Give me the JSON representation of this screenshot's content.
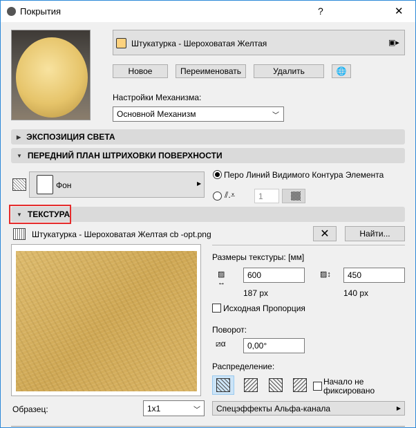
{
  "window": {
    "title": "Покрытия",
    "help": "?",
    "close": "✕"
  },
  "material": {
    "name": "Штукатурка - Шероховатая Желтая",
    "swatch_color": "#fdd27e"
  },
  "buttons": {
    "new": "Новое",
    "rename": "Переименовать",
    "delete": "Удалить"
  },
  "engine": {
    "label": "Настройки Механизма:",
    "value": "Основной Механизм"
  },
  "sections": {
    "light": "ЭКСПОЗИЦИЯ СВЕТА",
    "hatch": "ПЕРЕДНИЙ ПЛАН ШТРИХОВКИ ПОВЕРХНОСТИ",
    "texture": "ТЕКСТУРА"
  },
  "hatch": {
    "fill_name": "Фон",
    "radio_contour": "Перо Линий Видимого Контура Элемента",
    "pen_value": "1"
  },
  "texture": {
    "file": "Штукатурка - Шероховатая Желтая cb -opt.png",
    "find": "Найти...",
    "size_label": "Размеры текстуры: [мм]",
    "width": "600",
    "height": "450",
    "width_px": "187 px",
    "height_px": "140 px",
    "proportion": "Исходная Пропорция",
    "rotation_label": "Поворот:",
    "rotation": "0,00°",
    "distribution_label": "Распределение:",
    "origin_free": "Начало не фиксировано"
  },
  "sample": {
    "label": "Образец:",
    "value": "1x1"
  },
  "alpha": {
    "label": "Спецэффекты Альфа-канала"
  }
}
